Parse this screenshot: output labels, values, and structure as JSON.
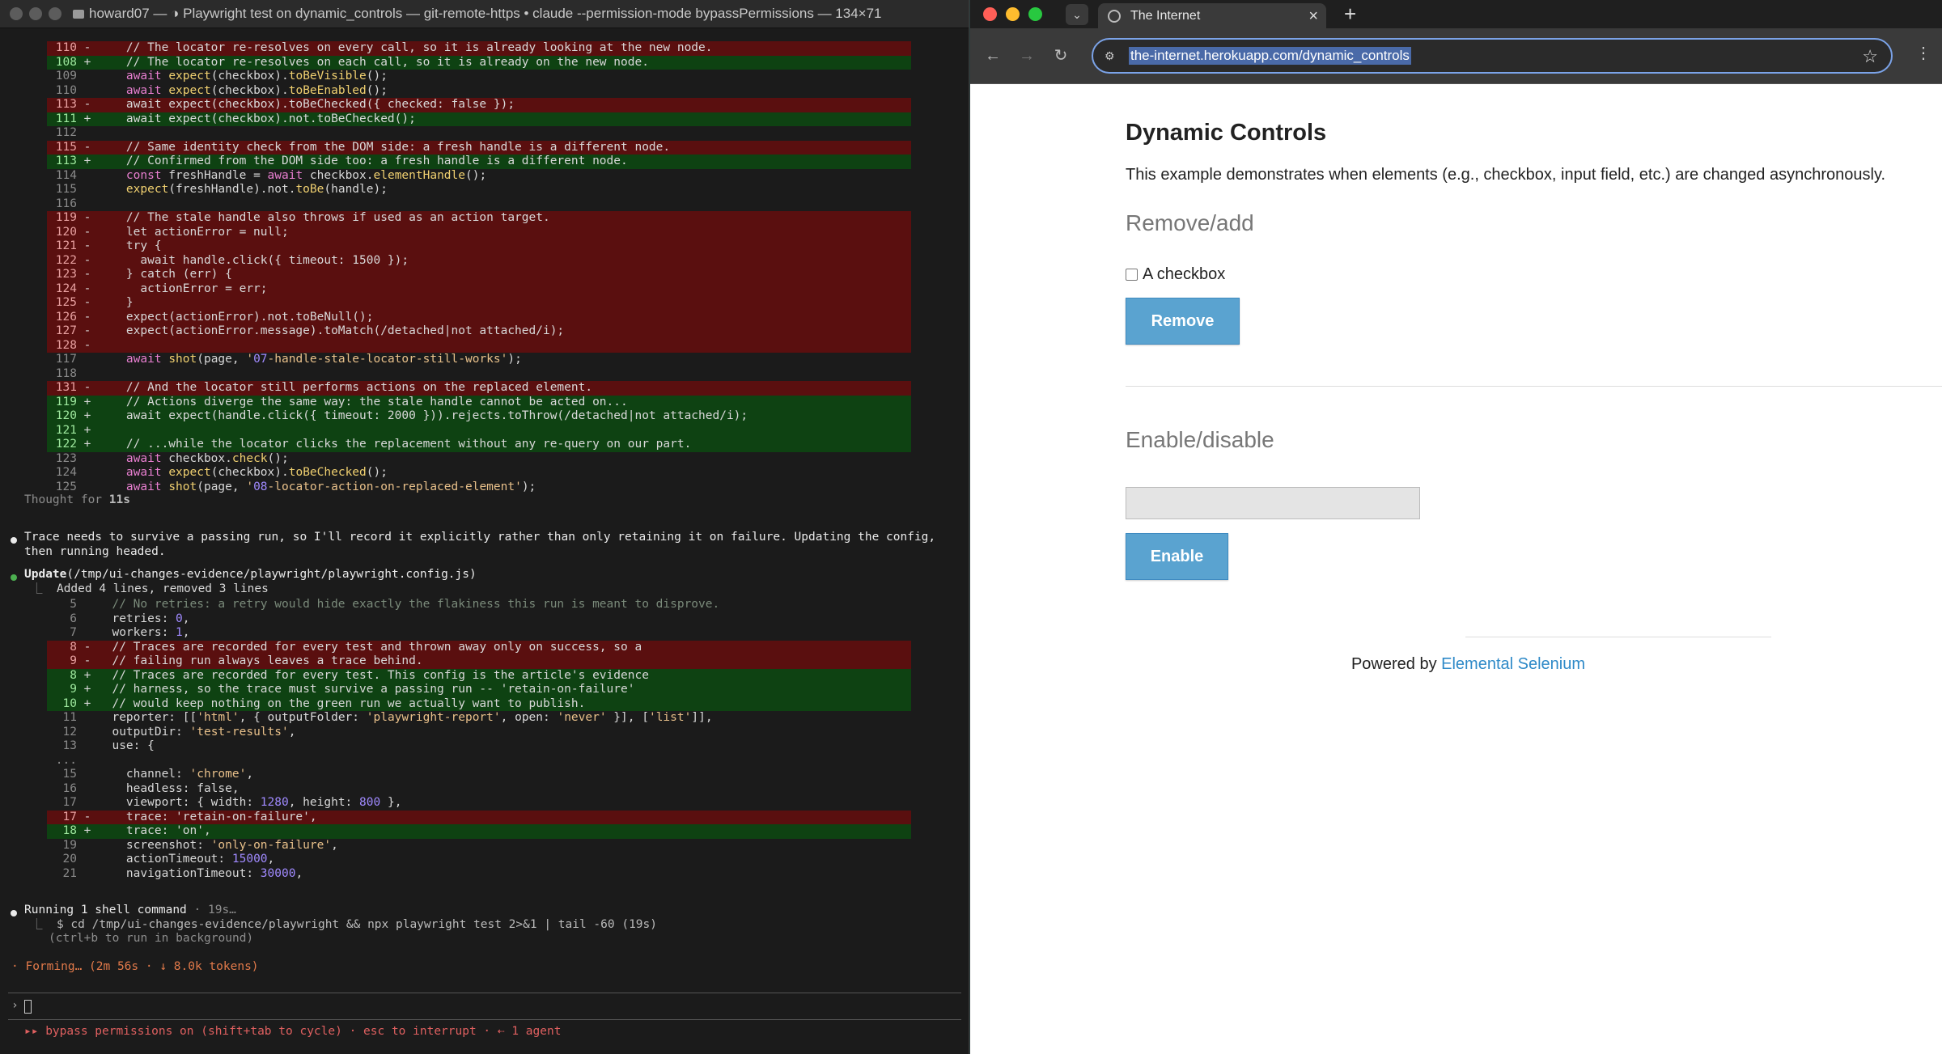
{
  "terminal": {
    "title": "howard07 — ◑ Playwright test on dynamic_controls — git-remote-https • claude --permission-mode bypassPermissions — 134×71",
    "thought_label": "Thought for ",
    "thought_time": "11s",
    "message": "Trace needs to survive a passing run, so I'll record it explicitly rather than only retaining it on failure. Updating the config,",
    "message_cont": "then running headed.",
    "update_label": "Update",
    "update_path": "(/tmp/ui-changes-evidence/playwright/playwright.config.js)",
    "update_summary": "Added 4 lines, removed 3 lines",
    "running_label": "Running 1 shell command",
    "running_time": " · 19s…",
    "shell_command": "$ cd /tmp/ui-changes-evidence/playwright && npx playwright test 2>&1 | tail -60 (19s)",
    "shell_hint": "(ctrl+b to run in background)",
    "forming": "· Forming… (2m 56s · ↓ 8.0k tokens)",
    "prompt_symbol": "›",
    "footer": "▸▸ bypass permissions on (shift+tab to cycle) · esc to interrupt · ⇠ 1 agent",
    "diff1": [
      {
        "n": "110",
        "s": "-",
        "k": "del",
        "c": "    // The locator re-resolves on every call, so it is already looking at the new node."
      },
      {
        "n": "108",
        "s": "+",
        "k": "add",
        "c": "    // The locator re-resolves on each call, so it is already on the new node."
      },
      {
        "n": "109",
        "s": "",
        "k": "ctx",
        "c": "    await expect(checkbox).toBeVisible();"
      },
      {
        "n": "110",
        "s": "",
        "k": "ctx",
        "c": "    await expect(checkbox).toBeEnabled();"
      },
      {
        "n": "113",
        "s": "-",
        "k": "del",
        "c": "    await expect(checkbox).toBeChecked({ checked: false });"
      },
      {
        "n": "111",
        "s": "+",
        "k": "add",
        "c": "    await expect(checkbox).not.toBeChecked();"
      },
      {
        "n": "112",
        "s": "",
        "k": "ctx",
        "c": ""
      },
      {
        "n": "115",
        "s": "-",
        "k": "del",
        "c": "    // Same identity check from the DOM side: a fresh handle is a different node."
      },
      {
        "n": "113",
        "s": "+",
        "k": "add",
        "c": "    // Confirmed from the DOM side too: a fresh handle is a different node."
      },
      {
        "n": "114",
        "s": "",
        "k": "ctx",
        "c": "    const freshHandle = await checkbox.elementHandle();"
      },
      {
        "n": "115",
        "s": "",
        "k": "ctx",
        "c": "    expect(freshHandle).not.toBe(handle);"
      },
      {
        "n": "116",
        "s": "",
        "k": "ctx",
        "c": ""
      },
      {
        "n": "119",
        "s": "-",
        "k": "del",
        "c": "    // The stale handle also throws if used as an action target."
      },
      {
        "n": "120",
        "s": "-",
        "k": "del",
        "c": "    let actionError = null;"
      },
      {
        "n": "121",
        "s": "-",
        "k": "del",
        "c": "    try {"
      },
      {
        "n": "122",
        "s": "-",
        "k": "del",
        "c": "      await handle.click({ timeout: 1500 });"
      },
      {
        "n": "123",
        "s": "-",
        "k": "del",
        "c": "    } catch (err) {"
      },
      {
        "n": "124",
        "s": "-",
        "k": "del",
        "c": "      actionError = err;"
      },
      {
        "n": "125",
        "s": "-",
        "k": "del",
        "c": "    }"
      },
      {
        "n": "126",
        "s": "-",
        "k": "del",
        "c": "    expect(actionError).not.toBeNull();"
      },
      {
        "n": "127",
        "s": "-",
        "k": "del",
        "c": "    expect(actionError.message).toMatch(/detached|not attached/i);"
      },
      {
        "n": "128",
        "s": "-",
        "k": "del",
        "c": ""
      },
      {
        "n": "117",
        "s": "",
        "k": "ctx",
        "c": "    await shot(page, '07-handle-stale-locator-still-works');"
      },
      {
        "n": "118",
        "s": "",
        "k": "ctx",
        "c": ""
      },
      {
        "n": "131",
        "s": "-",
        "k": "del",
        "c": "    // And the locator still performs actions on the replaced element."
      },
      {
        "n": "119",
        "s": "+",
        "k": "add",
        "c": "    // Actions diverge the same way: the stale handle cannot be acted on..."
      },
      {
        "n": "120",
        "s": "+",
        "k": "add",
        "c": "    await expect(handle.click({ timeout: 2000 })).rejects.toThrow(/detached|not attached/i);"
      },
      {
        "n": "121",
        "s": "+",
        "k": "add",
        "c": ""
      },
      {
        "n": "122",
        "s": "+",
        "k": "add",
        "c": "    // ...while the locator clicks the replacement without any re-query on our part."
      },
      {
        "n": "123",
        "s": "",
        "k": "ctx",
        "c": "    await checkbox.check();"
      },
      {
        "n": "124",
        "s": "",
        "k": "ctx",
        "c": "    await expect(checkbox).toBeChecked();"
      },
      {
        "n": "125",
        "s": "",
        "k": "ctx",
        "c": "    await shot(page, '08-locator-action-on-replaced-element');"
      }
    ],
    "diff2": [
      {
        "n": "5",
        "s": "",
        "k": "ctx",
        "c": "  // No retries: a retry would hide exactly the flakiness this run is meant to disprove."
      },
      {
        "n": "6",
        "s": "",
        "k": "ctx",
        "c": "  retries: 0,"
      },
      {
        "n": "7",
        "s": "",
        "k": "ctx",
        "c": "  workers: 1,"
      },
      {
        "n": "8",
        "s": "-",
        "k": "del",
        "c": "  // Traces are recorded for every test and thrown away only on success, so a"
      },
      {
        "n": "9",
        "s": "-",
        "k": "del",
        "c": "  // failing run always leaves a trace behind."
      },
      {
        "n": "8",
        "s": "+",
        "k": "add",
        "c": "  // Traces are recorded for every test. This config is the article's evidence"
      },
      {
        "n": "9",
        "s": "+",
        "k": "add",
        "c": "  // harness, so the trace must survive a passing run -- 'retain-on-failure'"
      },
      {
        "n": "10",
        "s": "+",
        "k": "add",
        "c": "  // would keep nothing on the green run we actually want to publish."
      },
      {
        "n": "11",
        "s": "",
        "k": "ctx",
        "c": "  reporter: [['html', { outputFolder: 'playwright-report', open: 'never' }], ['list']],"
      },
      {
        "n": "12",
        "s": "",
        "k": "ctx",
        "c": "  outputDir: 'test-results',"
      },
      {
        "n": "13",
        "s": "",
        "k": "ctx",
        "c": "  use: {"
      },
      {
        "n": "...",
        "s": "",
        "k": "ctx",
        "c": ""
      },
      {
        "n": "15",
        "s": "",
        "k": "ctx",
        "c": "    channel: 'chrome',"
      },
      {
        "n": "16",
        "s": "",
        "k": "ctx",
        "c": "    headless: false,"
      },
      {
        "n": "17",
        "s": "",
        "k": "ctx",
        "c": "    viewport: { width: 1280, height: 800 },"
      },
      {
        "n": "17",
        "s": "-",
        "k": "del",
        "c": "    trace: 'retain-on-failure',"
      },
      {
        "n": "18",
        "s": "+",
        "k": "add",
        "c": "    trace: 'on',"
      },
      {
        "n": "19",
        "s": "",
        "k": "ctx",
        "c": "    screenshot: 'only-on-failure',"
      },
      {
        "n": "20",
        "s": "",
        "k": "ctx",
        "c": "    actionTimeout: 15000,"
      },
      {
        "n": "21",
        "s": "",
        "k": "ctx",
        "c": "    navigationTimeout: 30000,"
      }
    ]
  },
  "browser": {
    "tab_title": "The Internet",
    "url": "the-internet.herokuapp.com/dynamic_controls",
    "page": {
      "title": "Dynamic Controls",
      "description": "This example demonstrates when elements (e.g., checkbox, input field, etc.) are changed asynchronously.",
      "section1_heading": "Remove/add",
      "checkbox_label": "A checkbox",
      "checkbox_checked": false,
      "remove_button": "Remove",
      "section2_heading": "Enable/disable",
      "input_value": "",
      "input_disabled": true,
      "enable_button": "Enable",
      "powered_by": "Powered by ",
      "powered_link": "Elemental Selenium"
    }
  },
  "colors": {
    "terminal_bg": "#1b1b1b",
    "diff_del_bg": "#5a0f0f",
    "diff_add_bg": "#0e4212",
    "button_blue": "#5aa3d0",
    "link_blue": "#2f8ac8"
  }
}
